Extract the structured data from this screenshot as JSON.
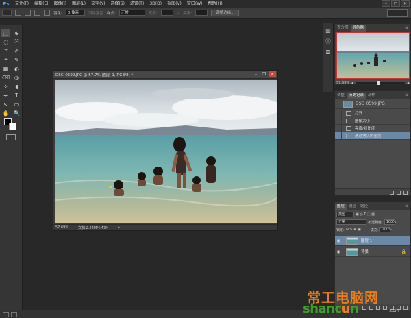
{
  "app": {
    "logo": "Ps"
  },
  "menu": [
    "文件(F)",
    "编辑(E)",
    "图像(I)",
    "图层(L)",
    "文字(Y)",
    "选择(S)",
    "滤镜(T)",
    "3D(D)",
    "视图(V)",
    "窗口(W)",
    "帮助(H)"
  ],
  "window_controls": {
    "minimize": "–",
    "maximize": "□",
    "close": "✕"
  },
  "options_bar": {
    "feather_label": "羽化:",
    "feather_value": "0 像素",
    "antialias_label": "消除锯齿",
    "style_label": "样式:",
    "style_value": "正常",
    "width_label": "宽度:",
    "height_label": "高度:",
    "refine_edge_button": "调整边缘..."
  },
  "tools": [
    "⬚",
    "⊕",
    "◌",
    "⤧",
    "⌗",
    "✐",
    "⌖",
    "✎",
    "▦",
    "◐",
    "⌫",
    "◎",
    "✧",
    "T",
    "↖",
    "▭",
    "✋",
    "🔍"
  ],
  "navigator": {
    "tabs": [
      "直方图",
      "导航器"
    ],
    "active_tab": 1,
    "zoom_value": "57.69%",
    "zoom_level": 0.45
  },
  "history": {
    "tabs": [
      "调整",
      "历史记录",
      "动作"
    ],
    "active_tab": 1,
    "snapshot_name": "DSC_0599.JPG",
    "items": [
      "打开",
      "图像大小",
      "亮度/对比度",
      "通过拷贝的图层"
    ],
    "selected_index": 3
  },
  "layers": {
    "tabs": [
      "图层",
      "通道",
      "路径"
    ],
    "active_tab": 0,
    "kind_filter": "类型",
    "blend_mode": "正常",
    "opacity_label": "不透明度:",
    "opacity_value": "100%",
    "lock_label": "锁定:",
    "fill_label": "填充:",
    "fill_value": "100%",
    "items": [
      {
        "name": "图层 1",
        "visible": true
      },
      {
        "name": "背景",
        "visible": true
      }
    ],
    "selected_index": 0,
    "eye_glyph": "◉",
    "lock_glyph": "🔒"
  },
  "document": {
    "title": "DSC_0599.JPG @ 57.7% (图层 1, RGB/8) *",
    "zoom": "57.69%",
    "doc_size": "文档:2.24M/4.47M",
    "status_arrow": "▸",
    "controls": {
      "minimize": "–",
      "maximize": "❐",
      "close": "✕"
    }
  },
  "watermark": {
    "brand": "常工电脑网",
    "url_start": "shanc",
    "url_o": "u",
    "url_end": "n",
    "tld": ".com"
  },
  "colors": {
    "accent_selected": "#6c88a7",
    "close_red": "#c44a3e",
    "watermark_orange": "#e87e1c",
    "watermark_green": "#3d9e2a"
  }
}
